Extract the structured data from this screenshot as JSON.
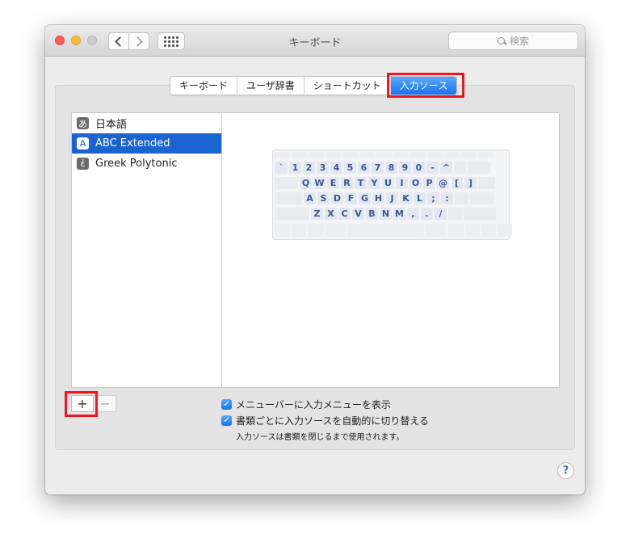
{
  "window": {
    "title": "キーボード"
  },
  "search": {
    "placeholder": "検索"
  },
  "tabs": [
    {
      "label": "キーボード",
      "active": false
    },
    {
      "label": "ユーザ辞書",
      "active": false
    },
    {
      "label": "ショートカット",
      "active": false
    },
    {
      "label": "入力ソース",
      "active": true
    }
  ],
  "input_sources": [
    {
      "icon_glyph": "あ",
      "icon": "hiragana-a-icon",
      "label": "日本語",
      "selected": false
    },
    {
      "icon_glyph": "A",
      "icon": "latin-a-icon",
      "label": "ABC Extended",
      "selected": true
    },
    {
      "icon_glyph": "ἐ",
      "icon": "greek-epsilon-icon",
      "label": "Greek Polytonic",
      "selected": false
    }
  ],
  "keyboard": {
    "row1": [
      "`",
      "1",
      "2",
      "3",
      "4",
      "5",
      "6",
      "7",
      "8",
      "9",
      "0",
      "-",
      "^"
    ],
    "row2": [
      "Q",
      "W",
      "E",
      "R",
      "T",
      "Y",
      "U",
      "I",
      "O",
      "P",
      "@",
      "[",
      "]"
    ],
    "row3": [
      "A",
      "S",
      "D",
      "F",
      "G",
      "H",
      "J",
      "K",
      "L",
      ";",
      ":"
    ],
    "row4": [
      "Z",
      "X",
      "C",
      "V",
      "B",
      "N",
      "M",
      ",",
      ".",
      "/"
    ]
  },
  "buttons": {
    "add": "+",
    "remove": "−",
    "help": "?"
  },
  "options": {
    "show_menu": {
      "label": "メニューバーに入力メニューを表示",
      "checked": true
    },
    "auto_switch": {
      "label": "書類ごとに入力ソースを自動的に切り替える",
      "checked": true
    },
    "note": "入力ソースは書類を閉じるまで使用されます。"
  },
  "colors": {
    "accent": "#1b63d1",
    "highlight": "#f0141e",
    "key_text": "#3e5696"
  }
}
